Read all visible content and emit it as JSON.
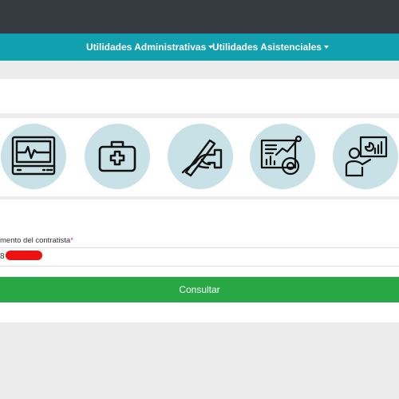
{
  "nav": {
    "items": [
      {
        "label": "Utilidades Administrativas"
      },
      {
        "label": "Utilidades Asistenciales"
      }
    ]
  },
  "icons": [
    {
      "name": "monitor-ecg-icon"
    },
    {
      "name": "medical-kit-icon"
    },
    {
      "name": "signing-hand-icon"
    },
    {
      "name": "analytics-dashboard-icon"
    },
    {
      "name": "presenter-chart-icon"
    }
  ],
  "form": {
    "label": "mento del contratista",
    "required_mark": "*",
    "input_value_prefix": "8"
  },
  "consult_button": {
    "label": "Consultar"
  },
  "colors": {
    "topbar": "#343a40",
    "navbar": "#11a0b0",
    "icon_circle": "#c7e1e6",
    "button": "#28a745",
    "required": "#dc3545"
  }
}
